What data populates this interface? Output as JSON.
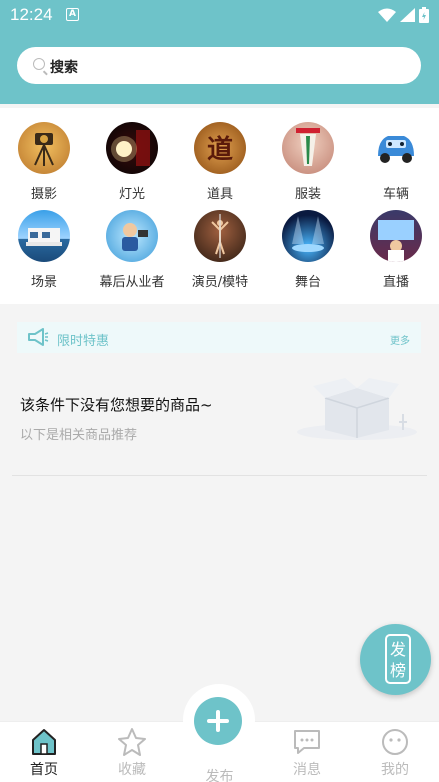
{
  "status": {
    "time": "12:24",
    "a_badge": "A"
  },
  "search": {
    "placeholder": "搜索"
  },
  "categories": [
    {
      "label": "摄影",
      "icon": "camera-icon"
    },
    {
      "label": "灯光",
      "icon": "light-icon"
    },
    {
      "label": "道具",
      "icon": "prop-icon"
    },
    {
      "label": "服装",
      "icon": "costume-icon"
    },
    {
      "label": "车辆",
      "icon": "car-icon"
    },
    {
      "label": "场景",
      "icon": "scene-icon"
    },
    {
      "label": "幕后从业者",
      "icon": "crew-icon"
    },
    {
      "label": "演员/模特",
      "icon": "actor-icon"
    },
    {
      "label": "舞台",
      "icon": "stage-icon"
    },
    {
      "label": "直播",
      "icon": "live-icon"
    }
  ],
  "promo": {
    "title": "限时特惠",
    "more": "更多",
    "prop_char": "道"
  },
  "empty": {
    "message": "该条件下没有您想要的商品~",
    "sub": "以下是相关商品推荐"
  },
  "float_rank": {
    "char1": "发",
    "char2": "榜"
  },
  "nav": {
    "home": "首页",
    "favorites": "收藏",
    "publish": "发布",
    "messages": "消息",
    "mine": "我的"
  },
  "colors": {
    "accent": "#6ec3c9",
    "background": "#f4f4f4",
    "inactive": "#bbbbbb"
  }
}
